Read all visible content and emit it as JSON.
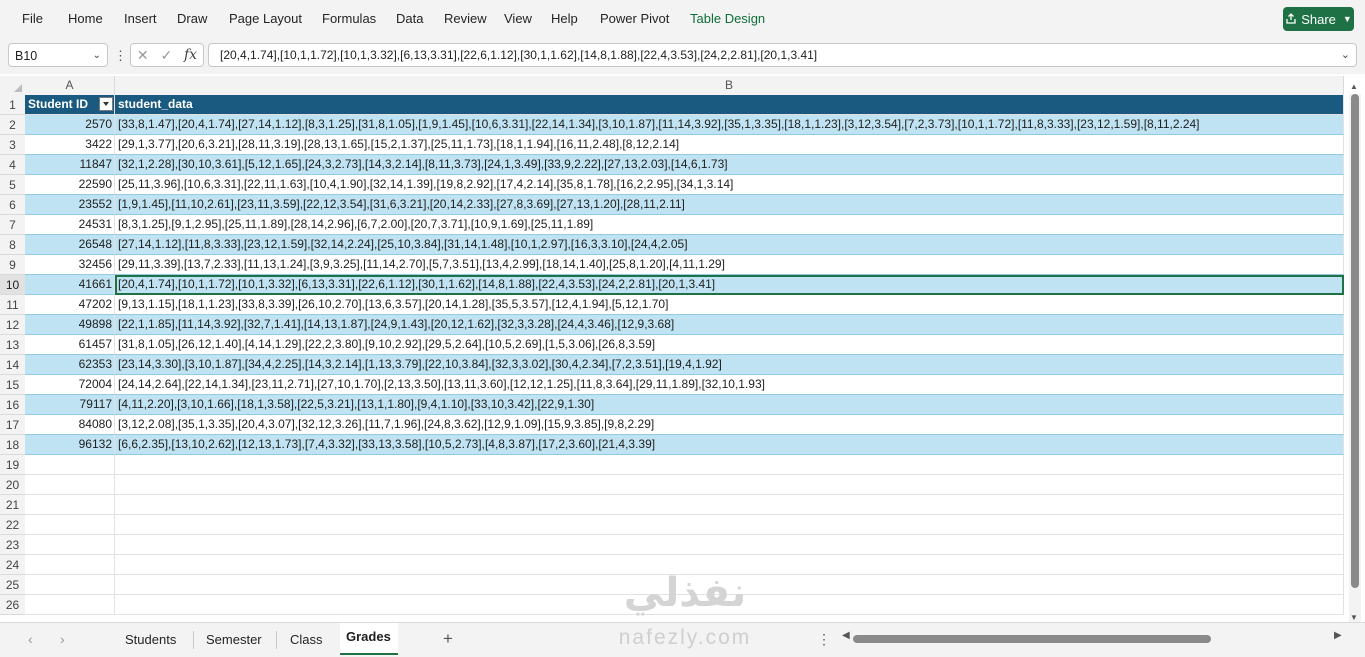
{
  "ribbon": {
    "menu": [
      {
        "id": "file",
        "label": "File"
      },
      {
        "id": "home",
        "label": "Home"
      },
      {
        "id": "insert",
        "label": "Insert"
      },
      {
        "id": "draw",
        "label": "Draw"
      },
      {
        "id": "page-layout",
        "label": "Page Layout"
      },
      {
        "id": "formulas",
        "label": "Formulas"
      },
      {
        "id": "data",
        "label": "Data"
      },
      {
        "id": "review",
        "label": "Review"
      },
      {
        "id": "view",
        "label": "View"
      },
      {
        "id": "help",
        "label": "Help"
      },
      {
        "id": "power-pivot",
        "label": "Power Pivot"
      },
      {
        "id": "table-design",
        "label": "Table Design"
      }
    ],
    "share_label": "Share",
    "accent_color": "#1e7145"
  },
  "formula_bar": {
    "name_box": "B10",
    "formula": "[20,4,1.74],[10,1,1.72],[10,1,3.32],[6,13,3.31],[22,6,1.12],[30,1,1.62],[14,8,1.88],[22,4,3.53],[24,2,2.81],[20,1,3.41]"
  },
  "grid": {
    "columns": [
      "A",
      "B"
    ],
    "header": {
      "col_a": "Student ID",
      "col_b": "student_data"
    },
    "rows": [
      {
        "n": "1",
        "a": "",
        "b": ""
      },
      {
        "n": "2",
        "a": "2570",
        "b": "[33,8,1.47],[20,4,1.74],[27,14,1.12],[8,3,1.25],[31,8,1.05],[1,9,1.45],[10,6,3.31],[22,14,1.34],[3,10,1.87],[11,14,3.92],[35,1,3.35],[18,1,1.23],[3,12,3.54],[7,2,3.73],[10,1,1.72],[11,8,3.33],[23,12,1.59],[8,11,2.24]"
      },
      {
        "n": "3",
        "a": "3422",
        "b": "[29,1,3.77],[20,6,3.21],[28,11,3.19],[28,13,1.65],[15,2,1.37],[25,11,1.73],[18,1,1.94],[16,11,2.48],[8,12,2.14]"
      },
      {
        "n": "4",
        "a": "11847",
        "b": "[32,1,2.28],[30,10,3.61],[5,12,1.65],[24,3,2.73],[14,3,2.14],[8,11,3.73],[24,1,3.49],[33,9,2.22],[27,13,2.03],[14,6,1.73]"
      },
      {
        "n": "5",
        "a": "22590",
        "b": "[25,11,3.96],[10,6,3.31],[22,11,1.63],[10,4,1.90],[32,14,1.39],[19,8,2.92],[17,4,2.14],[35,8,1.78],[16,2,2.95],[34,1,3.14]"
      },
      {
        "n": "6",
        "a": "23552",
        "b": "[1,9,1.45],[11,10,2.61],[23,11,3.59],[22,12,3.54],[31,6,3.21],[20,14,2.33],[27,8,3.69],[27,13,1.20],[28,11,2.11]"
      },
      {
        "n": "7",
        "a": "24531",
        "b": "[8,3,1.25],[9,1,2.95],[25,11,1.89],[28,14,2.96],[6,7,2.00],[20,7,3.71],[10,9,1.69],[25,11,1.89]"
      },
      {
        "n": "8",
        "a": "26548",
        "b": "[27,14,1.12],[11,8,3.33],[23,12,1.59],[32,14,2.24],[25,10,3.84],[31,14,1.48],[10,1,2.97],[16,3,3.10],[24,4,2.05]"
      },
      {
        "n": "9",
        "a": "32456",
        "b": "[29,11,3.39],[13,7,2.33],[11,13,1.24],[3,9,3.25],[11,14,2.70],[5,7,3.51],[13,4,2.99],[18,14,1.40],[25,8,1.20],[4,11,1.29]"
      },
      {
        "n": "10",
        "a": "41661",
        "b": "[20,4,1.74],[10,1,1.72],[10,1,3.32],[6,13,3.31],[22,6,1.12],[30,1,1.62],[14,8,1.88],[22,4,3.53],[24,2,2.81],[20,1,3.41]"
      },
      {
        "n": "11",
        "a": "47202",
        "b": "[9,13,1.15],[18,1,1.23],[33,8,3.39],[26,10,2.70],[13,6,3.57],[20,14,1.28],[35,5,3.57],[12,4,1.94],[5,12,1.70]"
      },
      {
        "n": "12",
        "a": "49898",
        "b": "[22,1,1.85],[11,14,3.92],[32,7,1.41],[14,13,1.87],[24,9,1.43],[20,12,1.62],[32,3,3.28],[24,4,3.46],[12,9,3.68]"
      },
      {
        "n": "13",
        "a": "61457",
        "b": "[31,8,1.05],[26,12,1.40],[4,14,1.29],[22,2,3.80],[9,10,2.92],[29,5,2.64],[10,5,2.69],[1,5,3.06],[26,8,3.59]"
      },
      {
        "n": "14",
        "a": "62353",
        "b": "[23,14,3.30],[3,10,1.87],[34,4,2.25],[14,3,2.14],[1,13,3.79],[22,10,3.84],[32,3,3.02],[30,4,2.34],[7,2,3.51],[19,4,1.92]"
      },
      {
        "n": "15",
        "a": "72004",
        "b": "[24,14,2.64],[22,14,1.34],[23,11,2.71],[27,10,1.70],[2,13,3.50],[13,11,3.60],[12,12,1.25],[11,8,3.64],[29,11,1.89],[32,10,1.93]"
      },
      {
        "n": "16",
        "a": "79117",
        "b": "[4,11,2.20],[3,10,1.66],[18,1,3.58],[22,5,3.21],[13,1,1.80],[9,4,1.10],[33,10,3.42],[22,9,1.30]"
      },
      {
        "n": "17",
        "a": "84080",
        "b": "[3,12,2.08],[35,1,3.35],[20,4,3.07],[32,12,3.26],[11,7,1.96],[24,8,3.62],[12,9,1.09],[15,9,3.85],[9,8,2.29]"
      },
      {
        "n": "18",
        "a": "96132",
        "b": "[6,6,2.35],[13,10,2.62],[12,13,1.73],[7,4,3.32],[33,13,3.58],[10,5,2.73],[4,8,3.87],[17,2,3.60],[21,4,3.39]"
      },
      {
        "n": "19",
        "a": "",
        "b": ""
      },
      {
        "n": "20",
        "a": "",
        "b": ""
      },
      {
        "n": "21",
        "a": "",
        "b": ""
      },
      {
        "n": "22",
        "a": "",
        "b": ""
      },
      {
        "n": "23",
        "a": "",
        "b": ""
      },
      {
        "n": "24",
        "a": "",
        "b": ""
      },
      {
        "n": "25",
        "a": "",
        "b": ""
      },
      {
        "n": "26",
        "a": "",
        "b": ""
      }
    ],
    "selected_row": "10",
    "table_header_color": "#1a5a80",
    "table_band_color": "#bfe3f2"
  },
  "sheets": {
    "tabs": [
      {
        "id": "students",
        "label": "Students"
      },
      {
        "id": "semester",
        "label": "Semester"
      },
      {
        "id": "class",
        "label": "Class"
      },
      {
        "id": "grades",
        "label": "Grades"
      }
    ],
    "active": "Grades",
    "add_label": "+"
  },
  "watermark": {
    "arabic": "نفذلي",
    "latin": "nafezly.com"
  },
  "icons": [
    "chevron-down-icon",
    "cancel-icon",
    "check-icon",
    "fx-icon",
    "share-icon",
    "filter-dropdown-icon",
    "more-icon",
    "arrow-left-icon",
    "arrow-right-icon"
  ]
}
